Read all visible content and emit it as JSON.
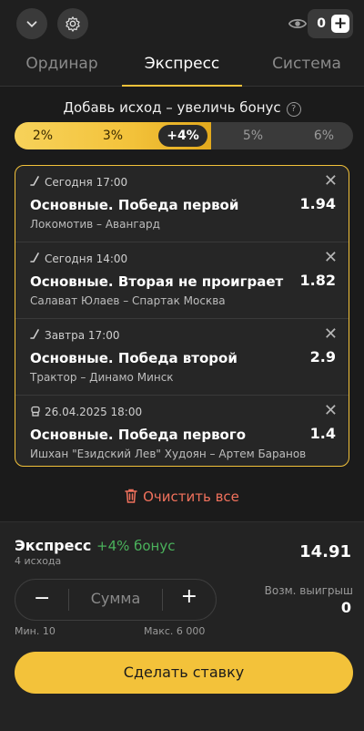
{
  "header": {
    "balance": "0",
    "plus_label": "+"
  },
  "tabs": [
    {
      "label": "Ординар"
    },
    {
      "label": "Экспресс"
    },
    {
      "label": "Система"
    }
  ],
  "bonus": {
    "title": "Добавь исход – увеличь бонус",
    "help": "?",
    "steps": [
      "2%",
      "3%",
      "+4%",
      "5%",
      "6%"
    ],
    "current_step": "+4%"
  },
  "bets": [
    {
      "time": "Сегодня 17:00",
      "market": "Основные. Победа первой",
      "odds": "1.94",
      "teams": "Локомотив – Авангард",
      "sport_icon": "hockey-stick-icon"
    },
    {
      "time": "Сегодня 14:00",
      "market": "Основные. Вторая не проиграет",
      "odds": "1.82",
      "teams": "Салават Юлаев – Спартак Москва",
      "sport_icon": "hockey-stick-icon"
    },
    {
      "time": "Завтра 17:00",
      "market": "Основные. Победа второй",
      "odds": "2.9",
      "teams": "Трактор – Динамо Минск",
      "sport_icon": "hockey-stick-icon"
    },
    {
      "time": "26.04.2025 18:00",
      "market": "Основные. Победа первого",
      "odds": "1.4",
      "teams": "Ишхан \"Езидский Лев\" Худоян – Артем Баранов",
      "sport_icon": "boxing-glove-icon"
    }
  ],
  "clear_label": "Очистить все",
  "summary": {
    "title": "Экспресс",
    "bonus": "+4% бонус",
    "count": "4 исхода",
    "total_odds": "14.91",
    "stake_placeholder": "Сумма",
    "minus": "−",
    "plus": "+",
    "win_label": "Возм. выигрыш",
    "win_value": "0",
    "min": "Мин. 10",
    "max": "Макс. 6 000",
    "button": "Сделать ставку"
  },
  "colors": {
    "accent": "#f3c23a",
    "bonus_green": "#4ab15b",
    "clear_red": "#f0715c",
    "background": "#1b1b1b"
  }
}
